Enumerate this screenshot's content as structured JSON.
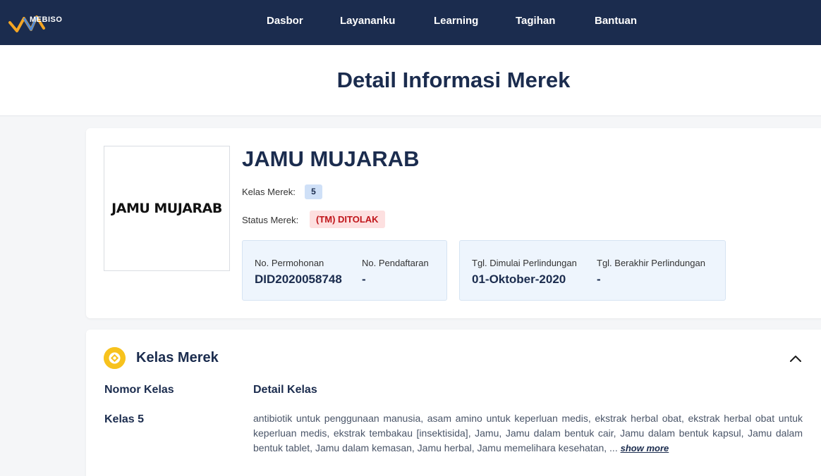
{
  "nav": {
    "logo_text": "MEBISO",
    "items": [
      "Dasbor",
      "Layananku",
      "Learning",
      "Tagihan",
      "Bantuan"
    ]
  },
  "page": {
    "title": "Detail Informasi Merek"
  },
  "brand": {
    "logo_text": "JAMU MUJARAB",
    "name": "JAMU MUJARAB",
    "kelas_label": "Kelas Merek:",
    "kelas_value": "5",
    "status_label": "Status Merek:",
    "status_value": "(TM) DITOLAK"
  },
  "info": {
    "no_permohonan_label": "No. Permohonan",
    "no_permohonan_value": "DID2020058748",
    "no_pendaftaran_label": "No. Pendaftaran",
    "no_pendaftaran_value": "-",
    "tgl_mulai_label": "Tgl. Dimulai Perlindungan",
    "tgl_mulai_value": "01-Oktober-2020",
    "tgl_akhir_label": "Tgl. Berakhir Perlindungan",
    "tgl_akhir_value": "-"
  },
  "kelas_section": {
    "title": "Kelas Merek",
    "col_nomor": "Nomor Kelas",
    "col_detail": "Detail Kelas",
    "rows": [
      {
        "nomor": "Kelas 5",
        "detail": "antibiotik untuk penggunaan manusia, asam amino untuk keperluan medis, ekstrak herbal obat, ekstrak herbal obat untuk keperluan medis, ekstrak tembakau [insektisida], Jamu, Jamu dalam bentuk cair, Jamu dalam bentuk kapsul, Jamu dalam bentuk tablet, Jamu dalam kemasan, Jamu herbal, Jamu memelihara kesehatan, ...",
        "show_more": "show more"
      }
    ]
  },
  "colors": {
    "navy": "#1b2c4e",
    "accent_yellow": "#f7c21d",
    "status_red": "#c0161b",
    "info_bg": "#eef5fd"
  }
}
